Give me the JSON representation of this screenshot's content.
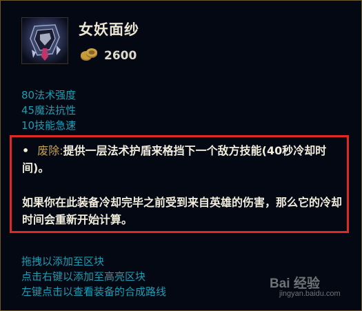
{
  "item": {
    "name": "女妖面纱",
    "icon": "banshees-veil-item-icon",
    "gold_icon": "gold-coins-icon",
    "cost": "2600"
  },
  "stats": [
    "80法术强度",
    "45魔法抗性",
    "10技能急速"
  ],
  "passive": {
    "bullet": "•",
    "name": "废除:",
    "desc1": "提供一层法术护盾来格挡下一个敌方技能(40秒冷却时间)。",
    "desc2": "如果你在此装备冷却完毕之前受到来自英雄的伤害，那么它的冷却时间会重新开始计算。"
  },
  "hints": [
    "拖拽以添加至区块",
    "点击右键以添加至高亮区块",
    "左键点击以查看装备的合成路线"
  ],
  "watermark": {
    "logo": "Bai 经验",
    "url": "jingyan.baidu.com"
  },
  "colors": {
    "stat_text": "#1f9db2",
    "title_text": "#ece6d5",
    "passive_name": "#c8a25a",
    "highlight_border": "#e02828",
    "frame_border": "#6e5a2c"
  }
}
